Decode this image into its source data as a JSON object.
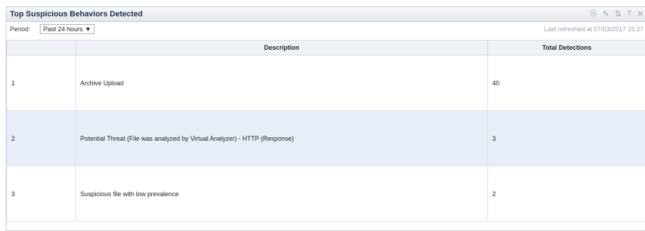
{
  "widget": {
    "title": "Top Suspicious Behaviors Detected",
    "tools": {
      "export_icon": "⎘",
      "edit_icon": "✎",
      "refresh_icon": "⇅",
      "help_icon": "?",
      "close_icon": "✕"
    }
  },
  "toolbar": {
    "period_label": "Period:",
    "period_value": "Past 24 hours",
    "period_arrow": "▼",
    "last_refreshed": "Last refreshed at 07/03/2017 15:27"
  },
  "table": {
    "headers": [
      "",
      "Description",
      "Total Detections"
    ],
    "rows": [
      {
        "rank": "1",
        "description": "Archive Upload",
        "total": "40"
      },
      {
        "rank": "2",
        "description": "Potential Threat (File was analyzed by Virtual Analyzer) - HTTP (Response)",
        "total": "3"
      },
      {
        "rank": "3",
        "description": "Suspicious file with low prevalence",
        "total": "2"
      }
    ]
  }
}
